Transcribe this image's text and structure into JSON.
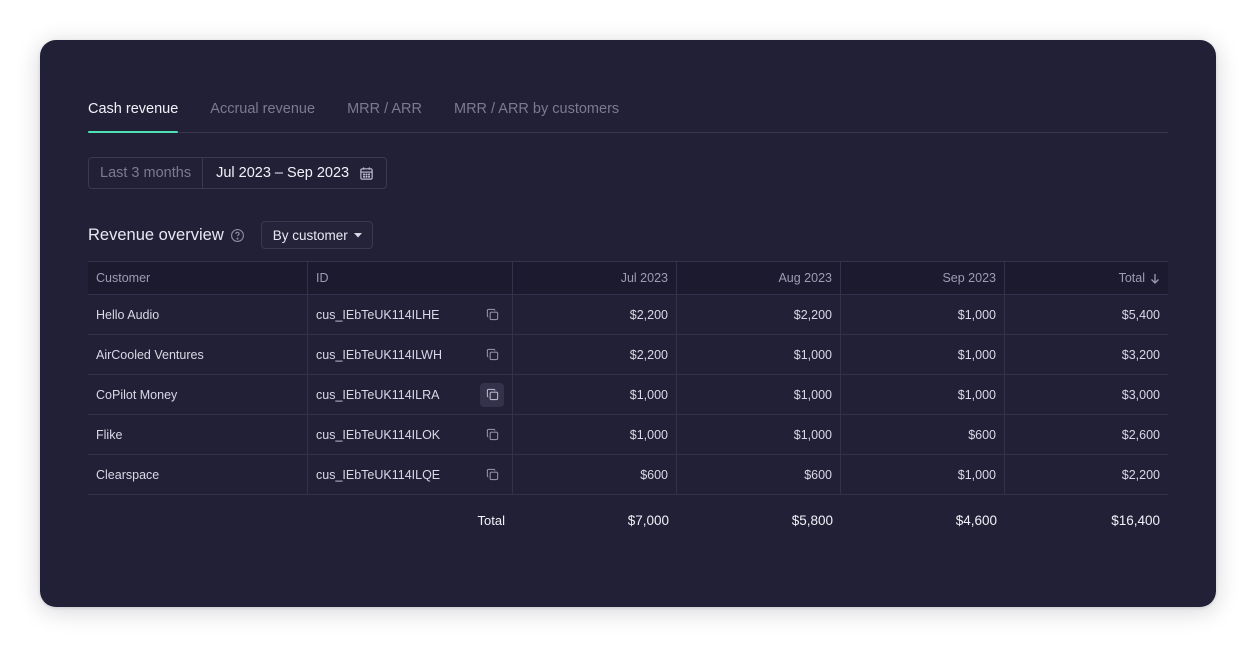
{
  "tabs": [
    {
      "label": "Cash revenue",
      "active": true
    },
    {
      "label": "Accrual revenue",
      "active": false
    },
    {
      "label": "MRR / ARR",
      "active": false
    },
    {
      "label": "MRR / ARR by customers",
      "active": false
    }
  ],
  "range": {
    "preset": "Last 3 months",
    "dates": "Jul 2023 – Sep 2023"
  },
  "section": {
    "title": "Revenue overview",
    "group_by": "By customer"
  },
  "table": {
    "headers": {
      "customer": "Customer",
      "id": "ID",
      "m1": "Jul 2023",
      "m2": "Aug 2023",
      "m3": "Sep 2023",
      "total": "Total"
    },
    "rows": [
      {
        "customer": "Hello Audio",
        "id": "cus_IEbTeUK114ILHE",
        "m1": "$2,200",
        "m2": "$2,200",
        "m3": "$1,000",
        "total": "$5,400"
      },
      {
        "customer": "AirCooled Ventures",
        "id": "cus_IEbTeUK114ILWH",
        "m1": "$2,200",
        "m2": "$1,000",
        "m3": "$1,000",
        "total": "$3,200"
      },
      {
        "customer": "CoPilot Money",
        "id": "cus_IEbTeUK114ILRA",
        "m1": "$1,000",
        "m2": "$1,000",
        "m3": "$1,000",
        "total": "$3,000"
      },
      {
        "customer": "Flike",
        "id": "cus_IEbTeUK114ILOK",
        "m1": "$1,000",
        "m2": "$1,000",
        "m3": "$600",
        "total": "$2,600"
      },
      {
        "customer": "Clearspace",
        "id": "cus_IEbTeUK114ILQE",
        "m1": "$600",
        "m2": "$600",
        "m3": "$1,000",
        "total": "$2,200"
      }
    ],
    "totals": {
      "label": "Total",
      "m1": "$7,000",
      "m2": "$5,800",
      "m3": "$4,600",
      "total": "$16,400"
    }
  },
  "colors": {
    "card_bg": "#222036",
    "accent": "#4fe0b4"
  },
  "icons": {
    "calendar": "calendar-icon",
    "help": "help-circle-icon",
    "dropdown": "caret-down-icon",
    "copy": "copy-icon",
    "sort": "arrow-down-icon"
  }
}
